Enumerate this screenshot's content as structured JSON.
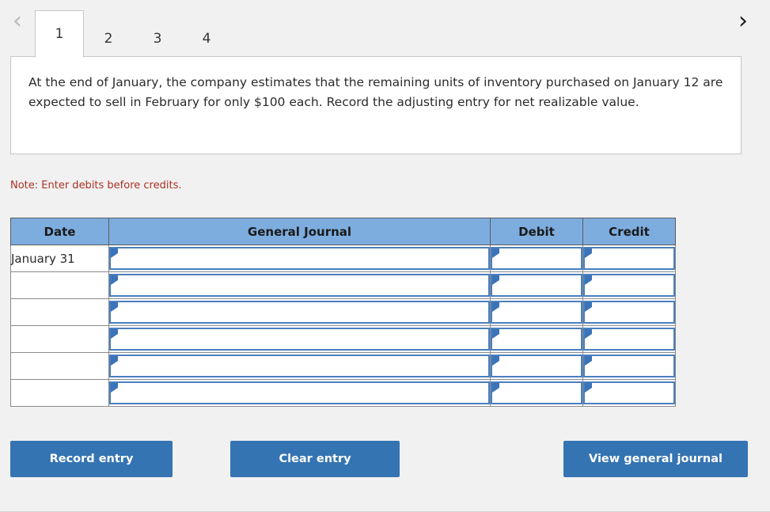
{
  "nav": {
    "prev_icon": "chevron-left-icon",
    "next_icon": "chevron-right-icon",
    "prev_label": "‹",
    "next_label": "›"
  },
  "tabs": [
    {
      "label": "1",
      "active": true
    },
    {
      "label": "2",
      "active": false
    },
    {
      "label": "3",
      "active": false
    },
    {
      "label": "4",
      "active": false
    }
  ],
  "question": {
    "text": "At the end of January, the company estimates that the remaining units of inventory purchased on January 12 are expected to sell in February for only $100 each. Record the adjusting entry for net realizable value."
  },
  "note": {
    "text": "Note: Enter debits before credits.",
    "color": "#a93226"
  },
  "journal": {
    "headers": {
      "date": "Date",
      "general_journal": "General Journal",
      "debit": "Debit",
      "credit": "Credit"
    },
    "header_bg": "#7daddf",
    "input_border": "#4a7fbf",
    "rows": [
      {
        "date": "January 31",
        "general_journal": "",
        "debit": "",
        "credit": ""
      },
      {
        "date": "",
        "general_journal": "",
        "debit": "",
        "credit": ""
      },
      {
        "date": "",
        "general_journal": "",
        "debit": "",
        "credit": ""
      },
      {
        "date": "",
        "general_journal": "",
        "debit": "",
        "credit": ""
      },
      {
        "date": "",
        "general_journal": "",
        "debit": "",
        "credit": ""
      },
      {
        "date": "",
        "general_journal": "",
        "debit": "",
        "credit": ""
      }
    ]
  },
  "buttons": {
    "record": "Record entry",
    "clear": "Clear entry",
    "view": "View general journal",
    "color": "#3574b2"
  }
}
